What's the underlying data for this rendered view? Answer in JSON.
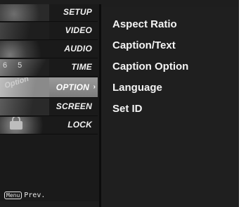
{
  "nav": {
    "items": [
      {
        "label": "SETUP",
        "thumb_text": ""
      },
      {
        "label": "VIDEO",
        "thumb_text": ""
      },
      {
        "label": "AUDIO",
        "thumb_text": ""
      },
      {
        "label": "TIME",
        "thumb_text": "6 5"
      },
      {
        "label": "OPTION",
        "thumb_text": "Option"
      },
      {
        "label": "SCREEN",
        "thumb_text": ""
      },
      {
        "label": "LOCK",
        "thumb_text": ""
      }
    ],
    "selected_index": 4,
    "selected_arrow": "›"
  },
  "footer": {
    "key_label": "Menu",
    "prev_label": "Prev."
  },
  "options": {
    "items": [
      "Aspect Ratio",
      "Caption/Text",
      "Caption Option",
      "Language",
      "Set ID"
    ]
  },
  "colors": {
    "background": "#1e1e1e",
    "selected": "#8c8c8c",
    "text": "#f4f4f4"
  }
}
